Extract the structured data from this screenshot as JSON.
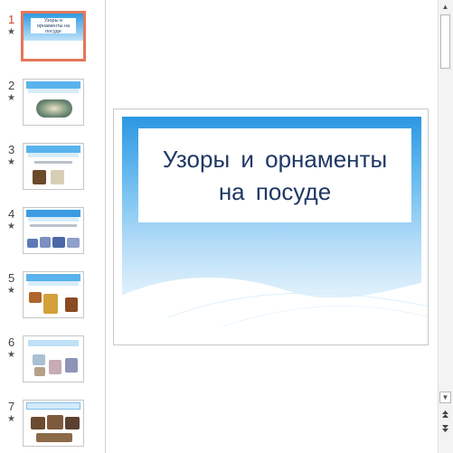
{
  "slides_panel": {
    "items": [
      {
        "number": "1",
        "star": "★",
        "title": "Узоры и орнаменты на посуде"
      },
      {
        "number": "2",
        "star": "★"
      },
      {
        "number": "3",
        "star": "★"
      },
      {
        "number": "4",
        "star": "★"
      },
      {
        "number": "5",
        "star": "★"
      },
      {
        "number": "6",
        "star": "★"
      },
      {
        "number": "7",
        "star": "★"
      }
    ],
    "selected_slide": 1
  },
  "main_slide": {
    "title": "Узоры и орнаменты на посуде"
  },
  "scrollbar": {
    "up_arrow": "▲",
    "down_arrow": "▼",
    "prev_slide_icon": "⯭",
    "next_slide_icon": "⯯"
  },
  "colors": {
    "accent_selected": "#e4775a",
    "slide_number_active": "#c9472c",
    "title_color": "#1f3864",
    "slide_blue_top": "#2c97e2"
  }
}
